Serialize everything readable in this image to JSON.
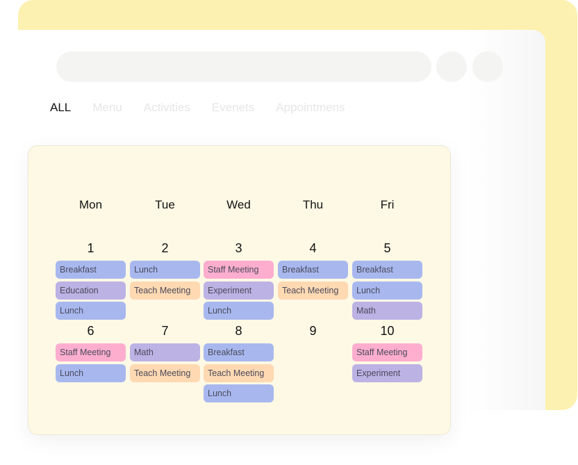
{
  "colors": {
    "frame": "#fdf1b1",
    "panel": "#fef9e5",
    "blue": "#a8b8ef",
    "purple": "#bcb2e4",
    "pink": "#fdaecf",
    "orange": "#fed9b2"
  },
  "tabs": [
    {
      "label": "ALL",
      "active": true
    },
    {
      "label": "Menu",
      "active": false
    },
    {
      "label": "Activities",
      "active": false
    },
    {
      "label": "Evenets",
      "active": false
    },
    {
      "label": "Appointmens",
      "active": false
    }
  ],
  "weekdays": [
    "Mon",
    "Tue",
    "Wed",
    "Thu",
    "Fri"
  ],
  "weeks": [
    {
      "days": [
        {
          "date": "1",
          "events": [
            {
              "label": "Breakfast",
              "color": "blue"
            },
            {
              "label": "Education",
              "color": "purple"
            },
            {
              "label": "Lunch",
              "color": "blue"
            }
          ]
        },
        {
          "date": "2",
          "events": [
            {
              "label": "Lunch",
              "color": "blue"
            },
            {
              "label": "Teach Meeting",
              "color": "orange"
            }
          ]
        },
        {
          "date": "3",
          "events": [
            {
              "label": "Staff Meeting",
              "color": "pink"
            },
            {
              "label": "Experiment",
              "color": "purple"
            },
            {
              "label": "Lunch",
              "color": "blue"
            }
          ]
        },
        {
          "date": "4",
          "events": [
            {
              "label": "Breakfast",
              "color": "blue"
            },
            {
              "label": "Teach Meeting",
              "color": "orange"
            }
          ]
        },
        {
          "date": "5",
          "events": [
            {
              "label": "Breakfast",
              "color": "blue"
            },
            {
              "label": "Lunch",
              "color": "blue"
            },
            {
              "label": "Math",
              "color": "purple"
            }
          ]
        }
      ]
    },
    {
      "days": [
        {
          "date": "6",
          "events": [
            {
              "label": "Staff Meeting",
              "color": "pink"
            },
            {
              "label": "Lunch",
              "color": "blue"
            }
          ]
        },
        {
          "date": "7",
          "events": [
            {
              "label": "Math",
              "color": "purple"
            },
            {
              "label": "Teach Meeting",
              "color": "orange"
            }
          ]
        },
        {
          "date": "8",
          "events": [
            {
              "label": "Breakfast",
              "color": "blue"
            },
            {
              "label": "Teach Meeting",
              "color": "orange"
            },
            {
              "label": "Lunch",
              "color": "blue"
            }
          ]
        },
        {
          "date": "9",
          "events": []
        },
        {
          "date": "10",
          "events": [
            {
              "label": "Staff Meeting",
              "color": "pink"
            },
            {
              "label": "Experiment",
              "color": "purple"
            }
          ]
        }
      ]
    }
  ]
}
